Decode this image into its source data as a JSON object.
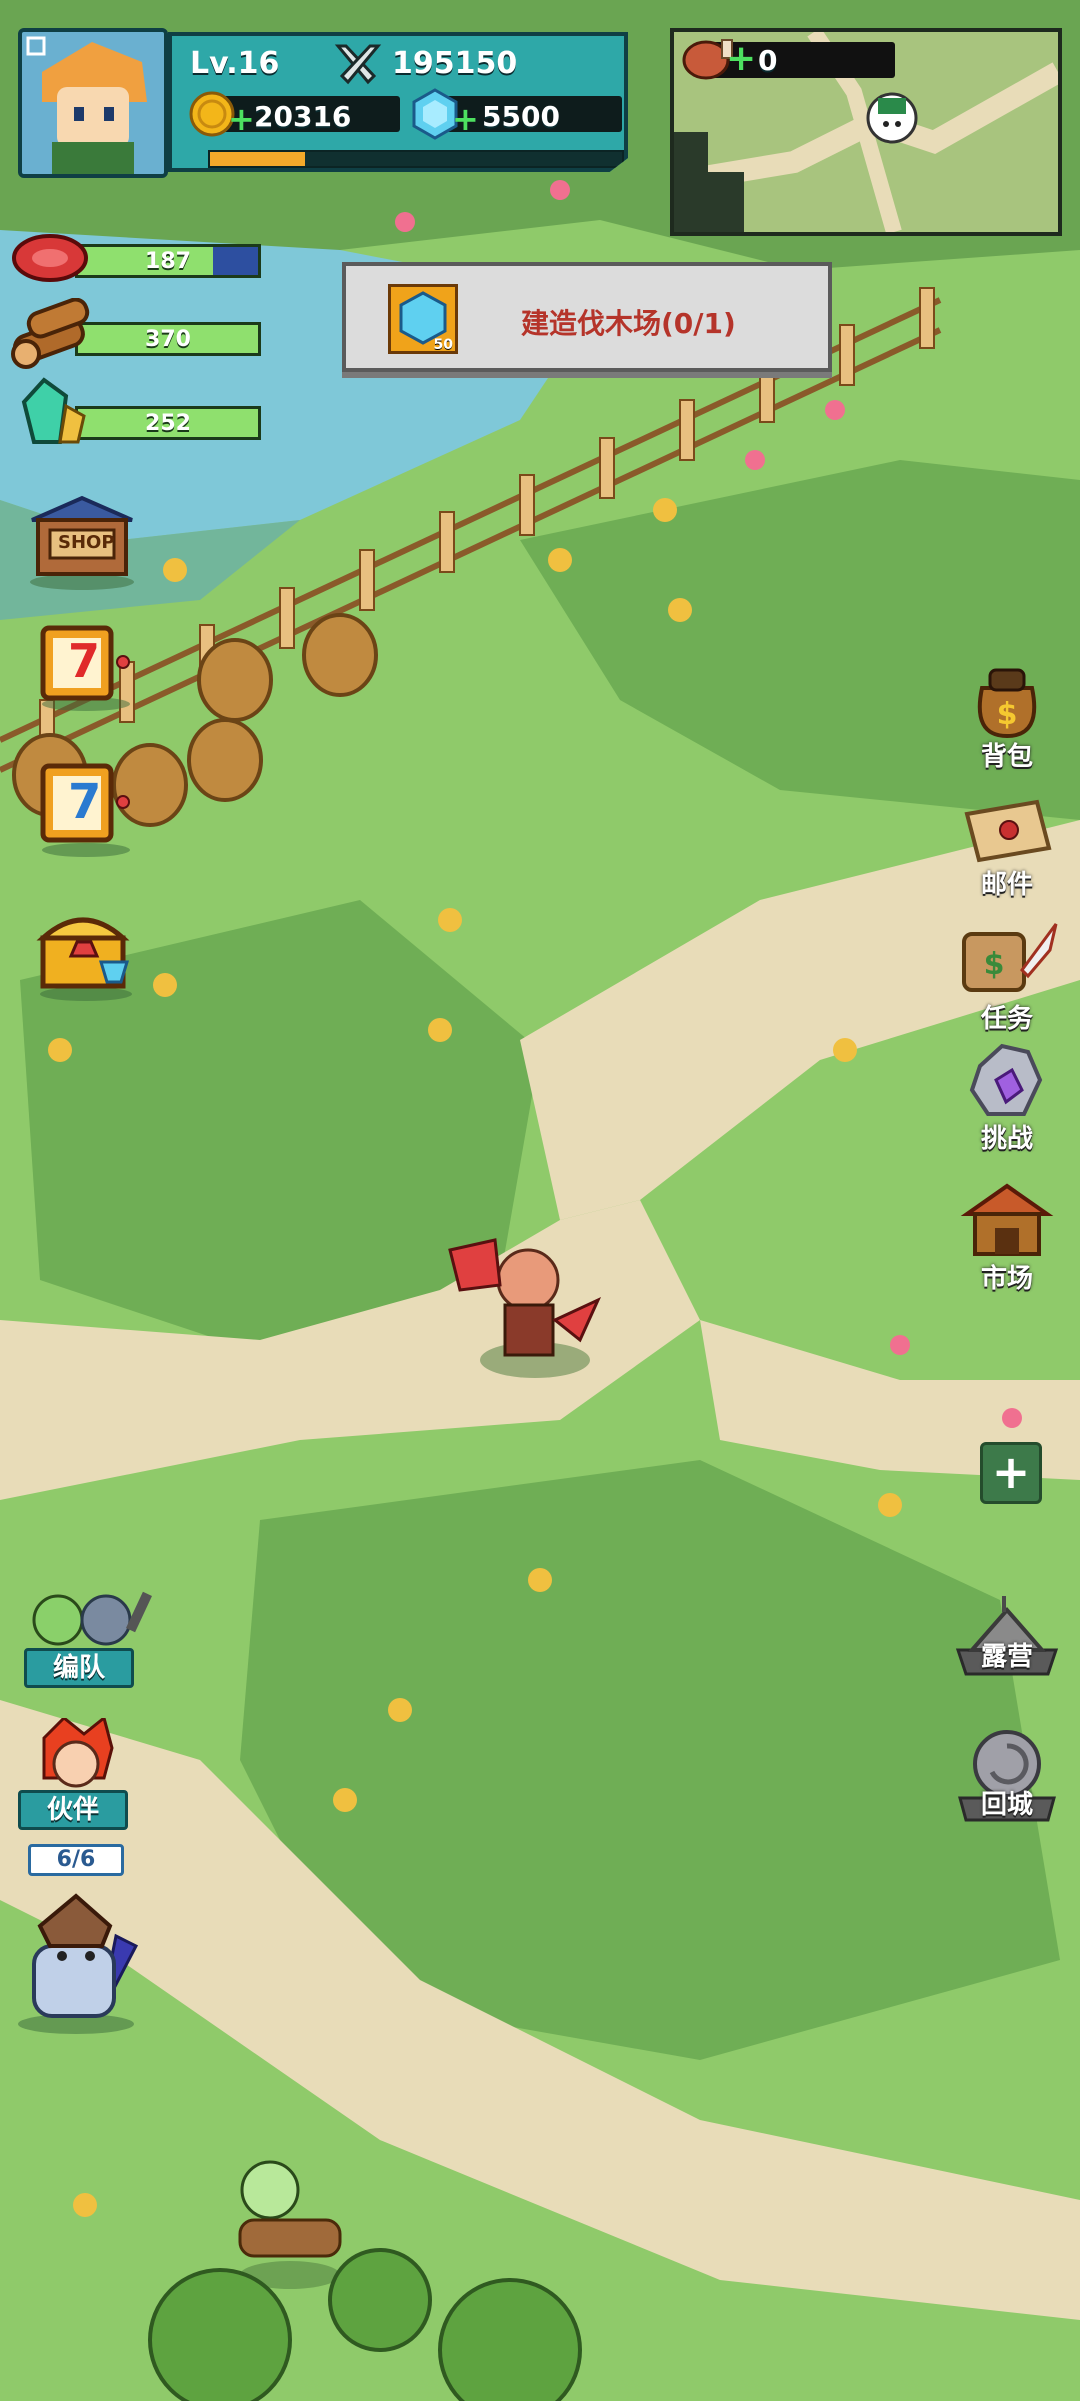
{
  "player": {
    "level": "Lv.16",
    "power": "195150",
    "gold": "20316",
    "gems": "5500",
    "xp_progress": 0.23
  },
  "resources": [
    {
      "name": "meat",
      "value": "187",
      "fill": 0.75
    },
    {
      "name": "wood",
      "value": "370",
      "fill": 1.0
    },
    {
      "name": "crystal",
      "value": "252",
      "fill": 1.0
    }
  ],
  "minimap": {
    "meat_count": "0"
  },
  "quest": {
    "icon_badge": "50",
    "text": "建造伐木场(0/1)"
  },
  "left_menu": {
    "shop_label": "SHOP",
    "slot1_number": "7",
    "slot2_number": "7",
    "team_label": "编队",
    "partner_label": "伙伴",
    "partner_count": "6/6"
  },
  "right_menu": {
    "bag": "背包",
    "mail": "邮件",
    "quest": "任务",
    "challenge": "挑战",
    "market": "市场",
    "camp": "露营",
    "return_city": "回城",
    "plus": "+"
  },
  "colors": {
    "panel_teal": "#2ea8a8",
    "quest_text": "#b5342a",
    "grass_light": "#8fca6a",
    "grass_dark": "#6fae55",
    "path": "#e8dcb8",
    "water": "#7fc8d8"
  }
}
